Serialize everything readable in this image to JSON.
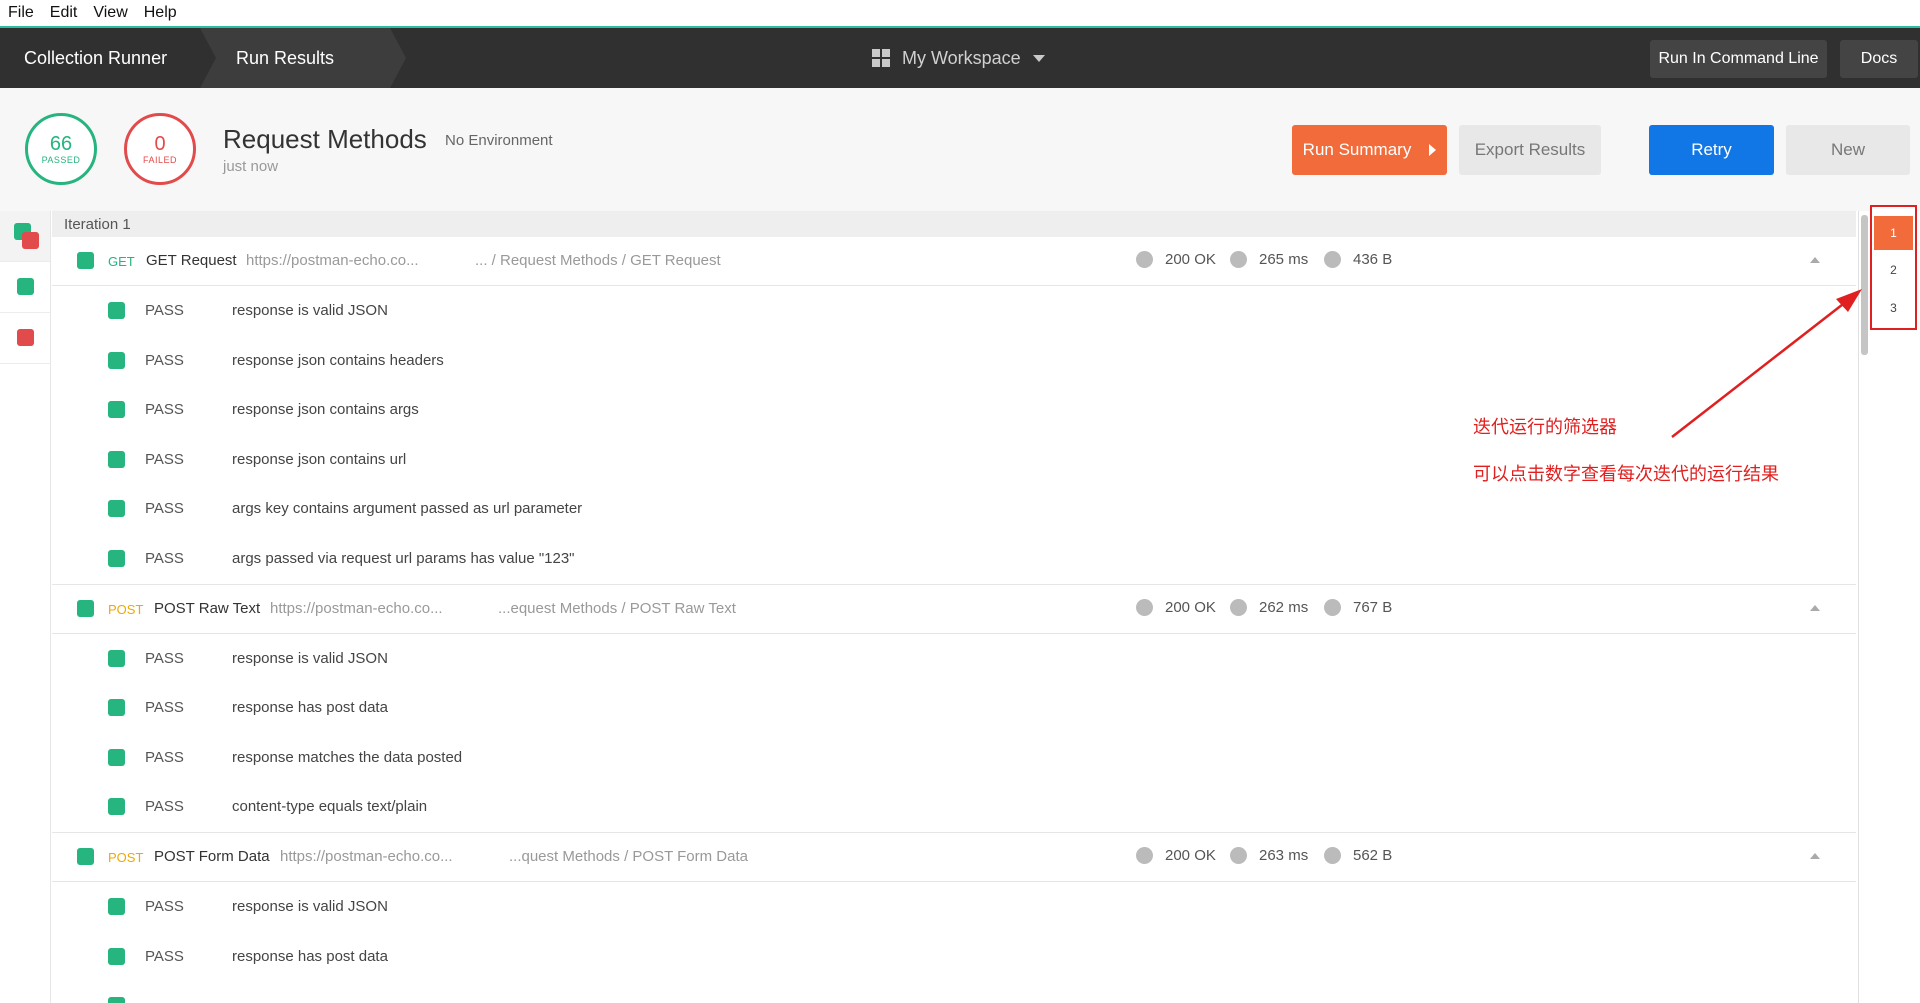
{
  "menubar": {
    "file": "File",
    "edit": "Edit",
    "view": "View",
    "help": "Help"
  },
  "header": {
    "crumb1": "Collection Runner",
    "crumb2": "Run Results",
    "workspace": "My Workspace",
    "cmd_button": "Run In Command Line",
    "docs_button": "Docs"
  },
  "summary": {
    "passed_count": "66",
    "passed_label": "PASSED",
    "failed_count": "0",
    "failed_label": "FAILED",
    "title": "Request Methods",
    "environment": "No Environment",
    "time": "just now",
    "run_summary_button": "Run Summary",
    "export_button": "Export Results",
    "retry_button": "Retry",
    "new_button": "New"
  },
  "iteration_label": "Iteration 1",
  "requests": [
    {
      "method": "GET",
      "name": "GET Request",
      "url": "https://postman-echo.co...",
      "path": "... / Request Methods / GET Request",
      "status": "200 OK",
      "time": "265 ms",
      "size": "436 B",
      "tests": [
        {
          "result": "PASS",
          "name": "response is valid JSON"
        },
        {
          "result": "PASS",
          "name": "response json contains headers"
        },
        {
          "result": "PASS",
          "name": "response json contains args"
        },
        {
          "result": "PASS",
          "name": "response json contains url"
        },
        {
          "result": "PASS",
          "name": "args key contains argument passed as url parameter"
        },
        {
          "result": "PASS",
          "name": "args passed via request url params has value \"123\""
        }
      ]
    },
    {
      "method": "POST",
      "name": "POST Raw Text",
      "url": "https://postman-echo.co...",
      "path": "...equest Methods / POST Raw Text",
      "status": "200 OK",
      "time": "262 ms",
      "size": "767 B",
      "tests": [
        {
          "result": "PASS",
          "name": "response is valid JSON"
        },
        {
          "result": "PASS",
          "name": "response has post data"
        },
        {
          "result": "PASS",
          "name": "response matches the data posted"
        },
        {
          "result": "PASS",
          "name": "content-type equals text/plain"
        }
      ]
    },
    {
      "method": "POST",
      "name": "POST Form Data",
      "url": "https://postman-echo.co...",
      "path": "...quest Methods / POST Form Data",
      "status": "200 OK",
      "time": "263 ms",
      "size": "562 B",
      "tests": [
        {
          "result": "PASS",
          "name": "response is valid JSON"
        },
        {
          "result": "PASS",
          "name": "response has post data"
        }
      ]
    }
  ],
  "iterations": [
    "1",
    "2",
    "3"
  ],
  "annotation": {
    "line1": "迭代运行的筛选器",
    "line2": "可以点击数字查看每次迭代的运行结果"
  },
  "colors": {
    "pass": "#26b47f",
    "fail": "#e24b4b",
    "accent_orange": "#f26b3a",
    "accent_blue": "#1277e6",
    "annotation": "#e02020"
  }
}
